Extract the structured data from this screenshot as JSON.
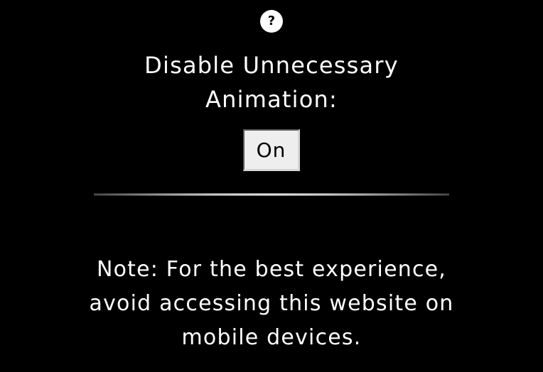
{
  "help": {
    "glyph": "?",
    "icon": "question-circle-icon"
  },
  "setting": {
    "label_line1": "Disable Unnecessary",
    "label_line2": "Animation:",
    "toggle_label": "On"
  },
  "note": {
    "line1": "Note: For the best experience,",
    "line2": "avoid accessing this website on",
    "line3": "mobile devices."
  },
  "colors": {
    "background": "#000000",
    "text": "#ffffff",
    "button_bg": "#eeeeee",
    "button_text": "#000000"
  }
}
